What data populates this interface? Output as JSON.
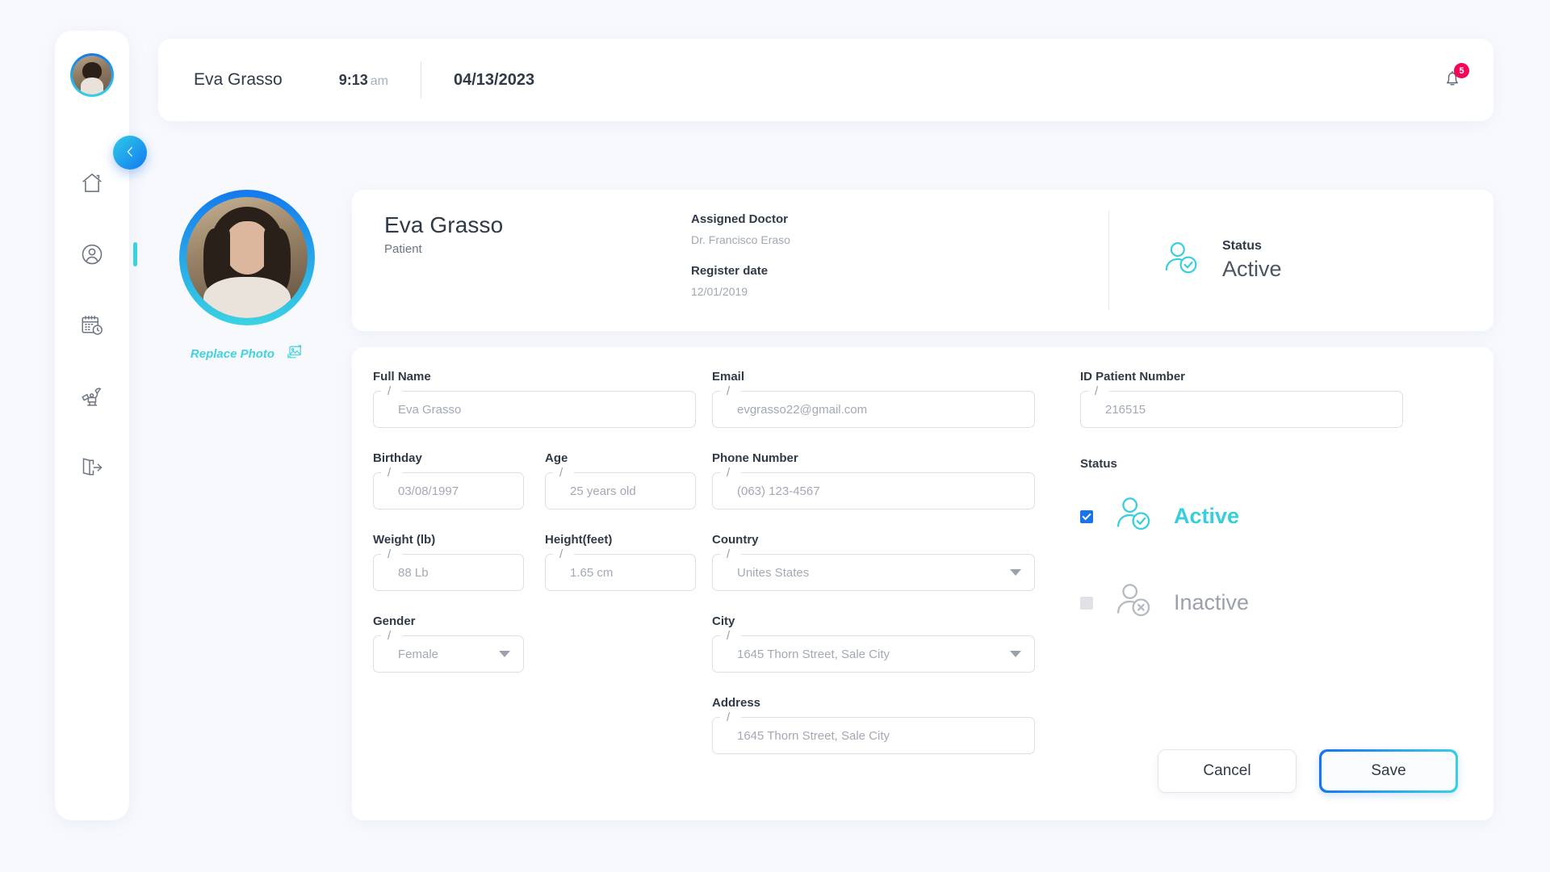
{
  "topbar": {
    "patient_name": "Eva Grasso",
    "time": "9:13",
    "ampm": "am",
    "date": "04/13/2023",
    "notification_count": "5"
  },
  "sidebar": {
    "items": [
      {
        "name": "home",
        "label": "Home",
        "active": false
      },
      {
        "name": "profile",
        "label": "Profile",
        "active": true
      },
      {
        "name": "appointments",
        "label": "Appointments",
        "active": false
      },
      {
        "name": "treatments",
        "label": "Treatments",
        "active": false
      },
      {
        "name": "logout",
        "label": "Logout",
        "active": false
      }
    ]
  },
  "avatar_panel": {
    "replace_photo_label": "Replace Photo"
  },
  "info_card": {
    "name": "Eva Grasso",
    "role": "Patient",
    "assigned_doctor_label": "Assigned Doctor",
    "assigned_doctor_value": "Dr. Francisco Eraso",
    "register_date_label": "Register date",
    "register_date_value": "12/01/2019",
    "status_label": "Status",
    "status_value": "Active"
  },
  "form": {
    "full_name": {
      "label": "Full Name",
      "value": "Eva Grasso"
    },
    "birthday": {
      "label": "Birthday",
      "value": "03/08/1997"
    },
    "age": {
      "label": "Age",
      "value": "25 years old"
    },
    "weight": {
      "label": "Weight (lb)",
      "value": "88 Lb"
    },
    "height": {
      "label": "Height(feet)",
      "value": "1.65 cm"
    },
    "gender": {
      "label": "Gender",
      "value": "Female"
    },
    "email": {
      "label": "Email",
      "value": "evgrasso22@gmail.com"
    },
    "phone": {
      "label": "Phone Number",
      "value": "(063) 123-4567"
    },
    "country": {
      "label": "Country",
      "value": "Unites States"
    },
    "city": {
      "label": "City",
      "value": "1645 Thorn Street, Sale City"
    },
    "address": {
      "label": "Address",
      "value": "1645 Thorn Street, Sale City"
    },
    "id_patient": {
      "label": "ID Patient Number",
      "value": "216515"
    },
    "status": {
      "label": "Status",
      "active_label": "Active",
      "inactive_label": "Inactive",
      "selected": "Active"
    },
    "buttons": {
      "cancel": "Cancel",
      "save": "Save"
    }
  },
  "colors": {
    "accent_cyan": "#35cfde",
    "accent_blue": "#1479ef",
    "badge_red": "#f5055a",
    "checkbox_blue": "#1a73e8",
    "page_bg": "#f7f9fd"
  }
}
